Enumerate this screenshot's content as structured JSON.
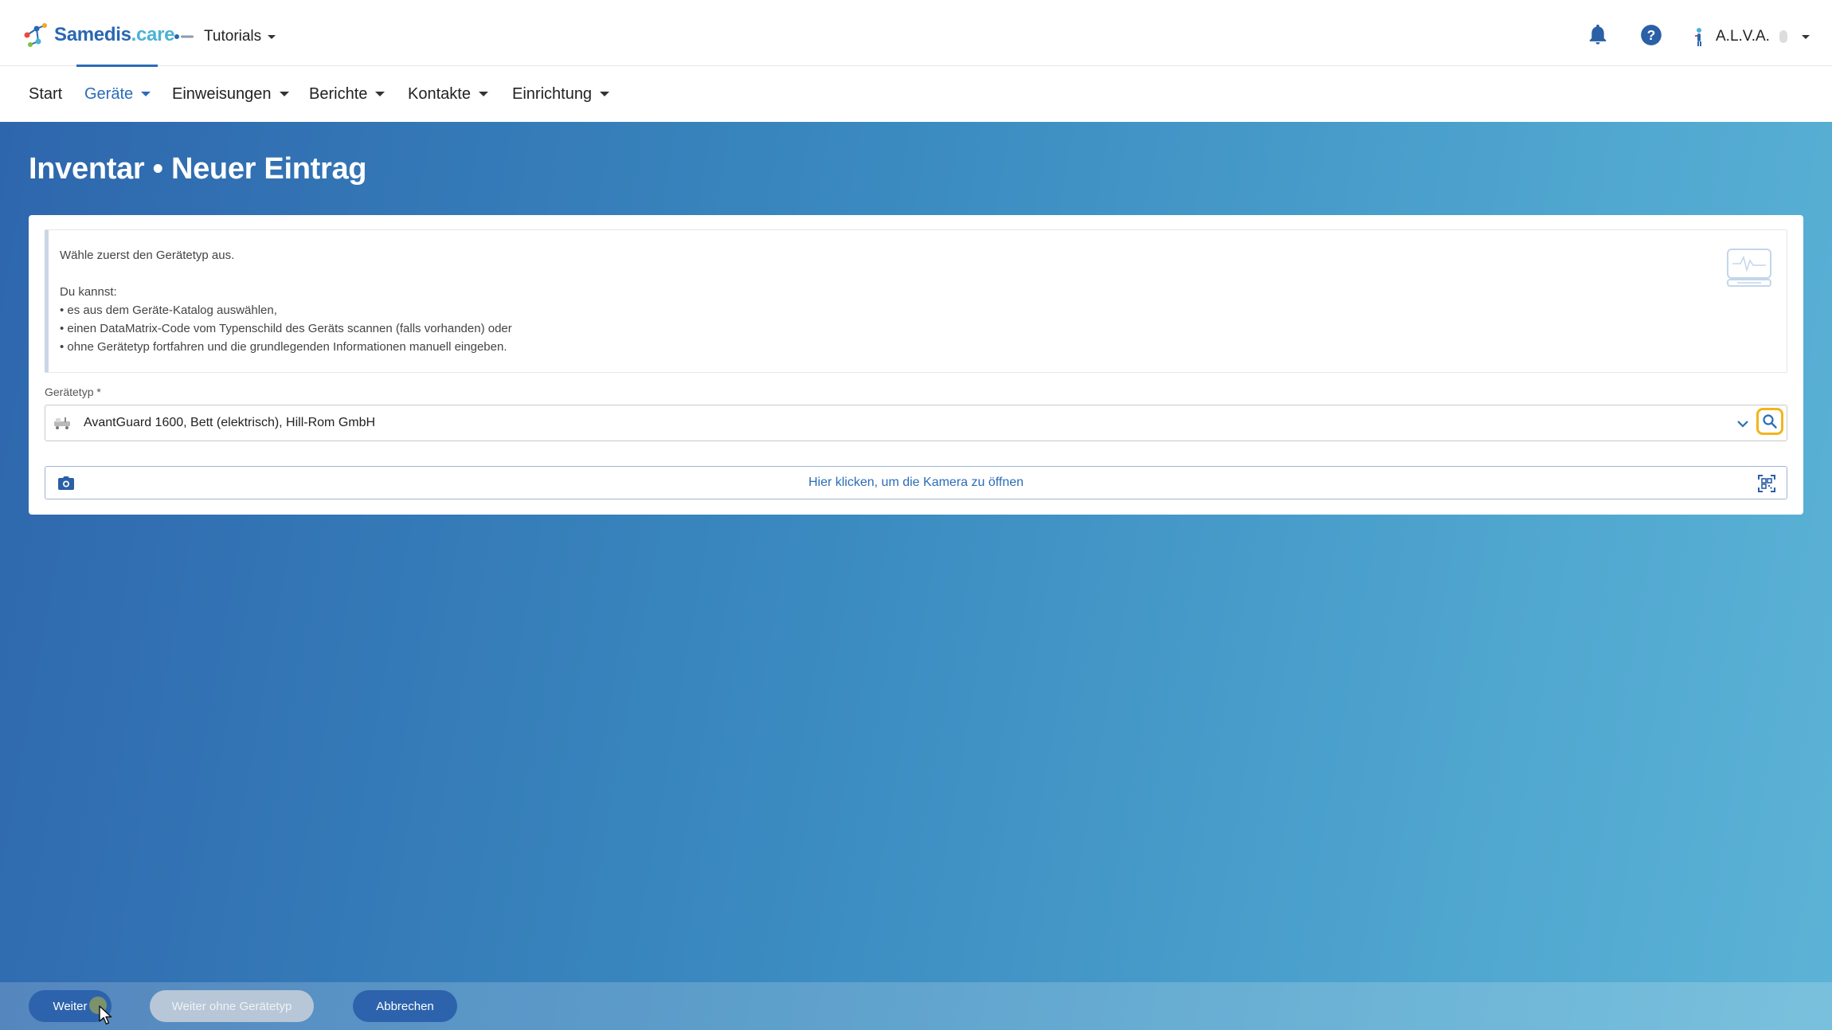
{
  "header": {
    "brand_name": "Samedis",
    "brand_suffix": ".care",
    "tenant_label": "Tutorials",
    "user_name": "A.L.V.A."
  },
  "nav": {
    "items": [
      {
        "label": "Start"
      },
      {
        "label": "Geräte"
      },
      {
        "label": "Einweisungen"
      },
      {
        "label": "Berichte"
      },
      {
        "label": "Kontakte"
      },
      {
        "label": "Einrichtung"
      }
    ]
  },
  "page": {
    "title": "Inventar • Neuer Eintrag"
  },
  "info": {
    "line1": "Wähle zuerst den Gerätetyp aus.",
    "line2": "Du kannst:",
    "bullets": [
      "• es aus dem Geräte-Katalog auswählen,",
      "• einen DataMatrix-Code vom Typenschild des Geräts scannen (falls vorhanden) oder",
      "• ohne Gerätetyp fortfahren und die grundlegenden Informationen manuell eingeben."
    ]
  },
  "form": {
    "device_type_label": "Gerätetyp *",
    "device_type_value": "AvantGuard 1600, Bett (elektrisch), Hill-Rom GmbH",
    "camera_text": "Hier klicken, um die Kamera zu öffnen"
  },
  "footer": {
    "next_label": "Weiter",
    "skip_label": "Weiter ohne Gerätetyp",
    "cancel_label": "Abbrechen"
  },
  "colors": {
    "primary": "#2b6cb8",
    "focus_ring": "#f2b51c",
    "header_bg": "#ffffff",
    "gradient_start": "#2e66ad",
    "gradient_end": "#5cb3d6"
  },
  "icons": {
    "notifications": "bell-icon",
    "help": "help-circle-icon",
    "search": "search-icon",
    "camera": "camera-icon",
    "scan": "qr-scan-icon"
  }
}
